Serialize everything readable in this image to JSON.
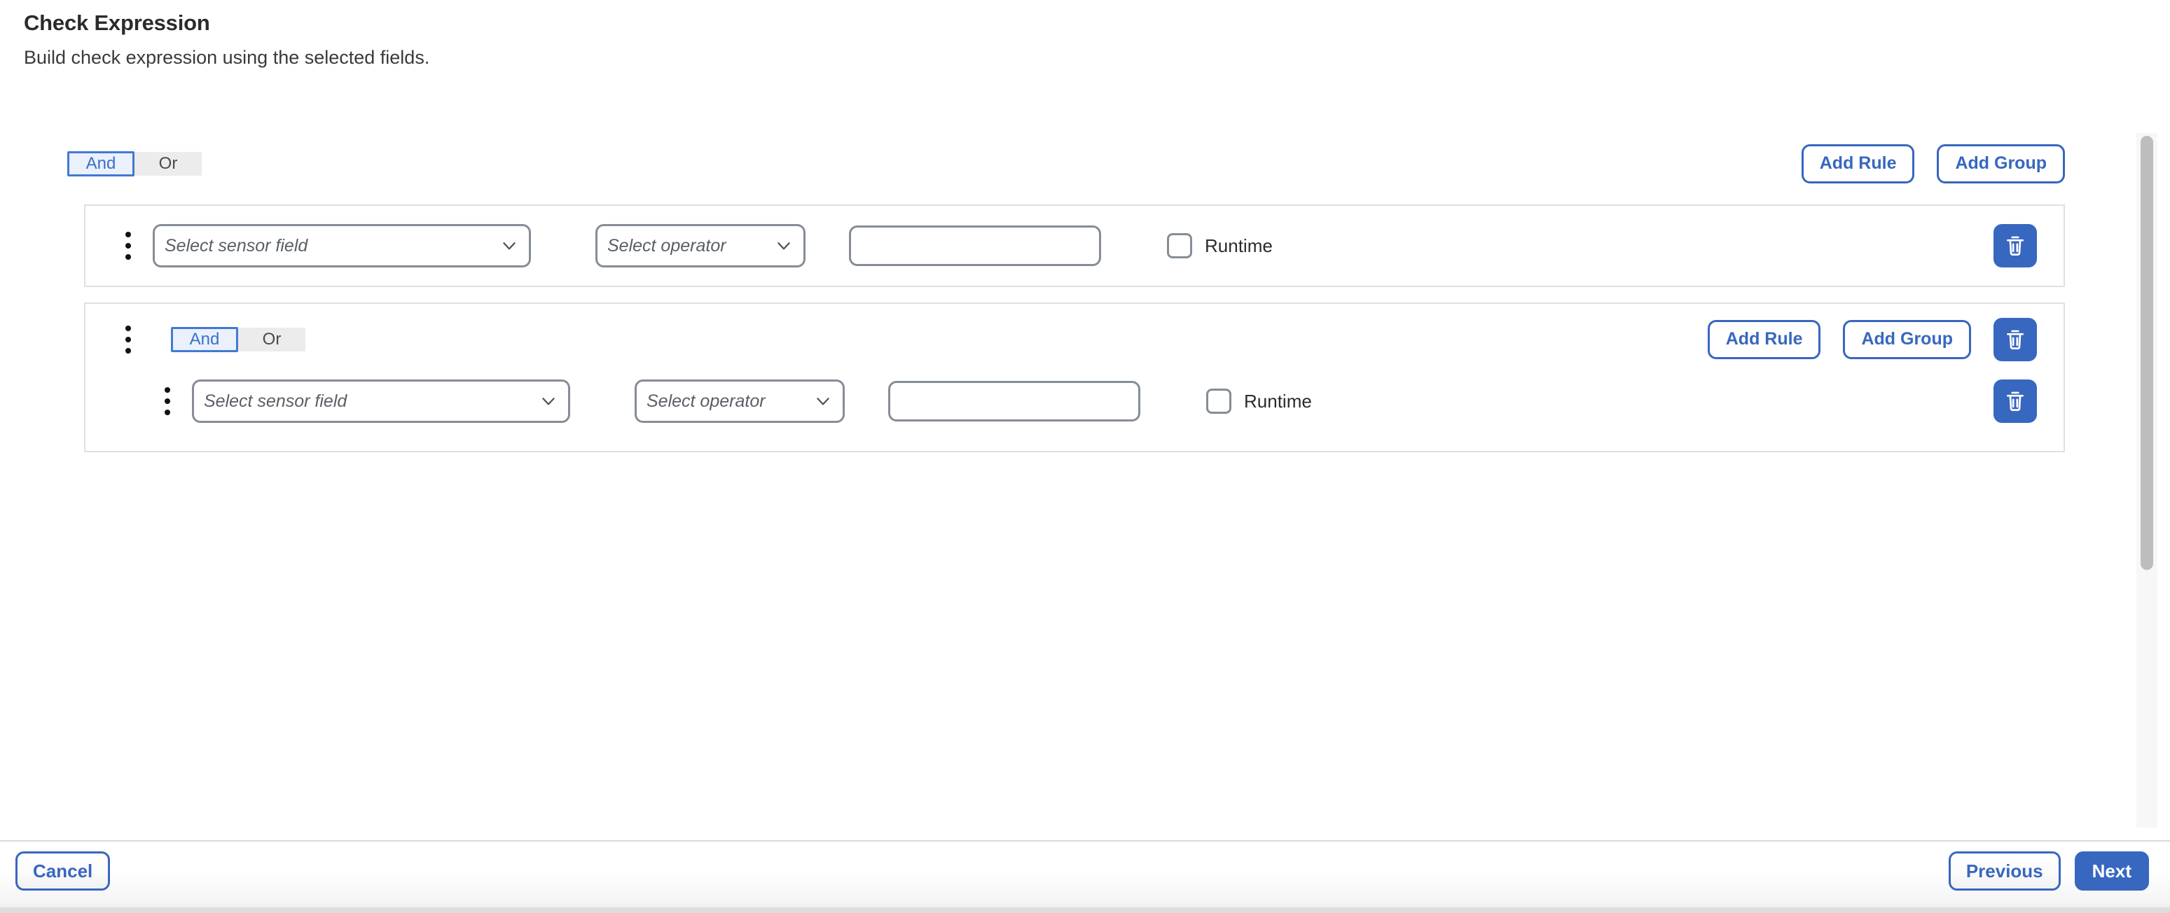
{
  "header": {
    "title": "Check Expression",
    "subtitle": "Build check expression using the selected fields."
  },
  "colors": {
    "accent_blue": "#3767bf",
    "toggle_active_border": "#4279d4",
    "toggle_active_bg": "#eaf1fc",
    "toggle_track_bg": "#ececec",
    "field_border": "#868d96",
    "box_border": "#e0e0e0",
    "scrollbar_thumb": "#bdbdbd"
  },
  "toolbar": {
    "add_rule_label": "Add Rule",
    "add_group_label": "Add Group",
    "delete_icon": "trash-icon"
  },
  "root_group": {
    "combinator": {
      "and_label": "And",
      "or_label": "Or",
      "selected": "And"
    },
    "add_rule_label": "Add Rule",
    "add_group_label": "Add Group",
    "rules": [
      {
        "drag_handle_icon": "drag-dots-icon",
        "field": {
          "placeholder": "Select sensor field",
          "value": "",
          "chevron_icon": "chevron-down-icon"
        },
        "operator": {
          "placeholder": "Select operator",
          "value": "",
          "chevron_icon": "chevron-down-icon"
        },
        "value_input": {
          "placeholder": "",
          "value": ""
        },
        "runtime": {
          "label": "Runtime",
          "checked": false
        },
        "delete_icon": "trash-icon"
      }
    ]
  },
  "nested_group": {
    "drag_handle_icon": "drag-dots-icon",
    "combinator": {
      "and_label": "And",
      "or_label": "Or",
      "selected": "And"
    },
    "add_rule_label": "Add Rule",
    "add_group_label": "Add Group",
    "delete_icon": "trash-icon",
    "rules": [
      {
        "drag_handle_icon": "drag-dots-icon",
        "field": {
          "placeholder": "Select sensor field",
          "value": "",
          "chevron_icon": "chevron-down-icon"
        },
        "operator": {
          "placeholder": "Select operator",
          "value": "",
          "chevron_icon": "chevron-down-icon"
        },
        "value_input": {
          "placeholder": "",
          "value": ""
        },
        "runtime": {
          "label": "Runtime",
          "checked": false
        },
        "delete_icon": "trash-icon"
      }
    ]
  },
  "footer": {
    "cancel_label": "Cancel",
    "previous_label": "Previous",
    "next_label": "Next"
  }
}
